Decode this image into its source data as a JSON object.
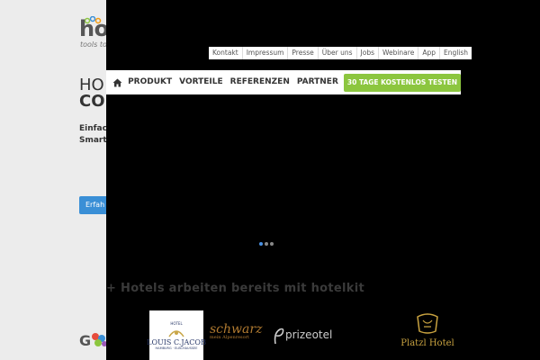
{
  "logo": {
    "word": "hotelkit",
    "tagline": "tools to organize your hotel"
  },
  "hero": {
    "title_line1": "HO",
    "title_line2": "CO",
    "subtitle_line1": "Einfac",
    "subtitle_line2": "Smart",
    "button_label": "Erfah"
  },
  "utility_nav": [
    {
      "label": "Kontakt"
    },
    {
      "label": "Impressum"
    },
    {
      "label": "Presse"
    },
    {
      "label": "Über uns"
    },
    {
      "label": "Jobs"
    },
    {
      "label": "Webinare"
    },
    {
      "label": "App"
    },
    {
      "label": "English"
    }
  ],
  "main_nav": {
    "items": [
      {
        "label": "PRODUKT"
      },
      {
        "label": "VORTEILE"
      },
      {
        "label": "REFERENZEN"
      },
      {
        "label": "PARTNER"
      }
    ],
    "cta_label": "30 TAGE KOSTENLOS TESTEN"
  },
  "slider": {
    "dot_count": 3,
    "active_index": 0
  },
  "hotels_count_text": "+ Hotels arbeiten bereits mit hotelkit",
  "partners": {
    "jacob": {
      "top": "HOTEL",
      "name": "LOUIS C.JACOB",
      "sub": "HAMBURG · ELBCHAUSSEE"
    },
    "schwarz": {
      "name": "schwarz",
      "sub": "mein Alpenresort"
    },
    "prizeotel": {
      "name": "prizeotel"
    },
    "platzl": {
      "name": "Platzl Hotel"
    }
  },
  "colors": {
    "accent_blue": "#3a8fd6",
    "cta_green": "#8cc63f",
    "overlay": "#000000"
  }
}
